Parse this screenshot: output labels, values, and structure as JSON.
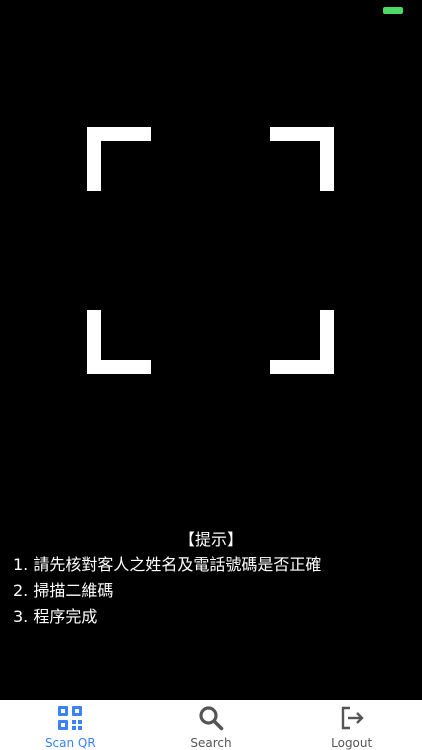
{
  "hints": {
    "title": "【提示】",
    "items": [
      "1. 請先核對客人之姓名及電話號碼是否正確",
      "2. 掃描二維碼",
      "3. 程序完成"
    ]
  },
  "tabs": [
    {
      "label": "Scan QR",
      "icon": "qr-code-icon",
      "active": true
    },
    {
      "label": "Search",
      "icon": "search-icon",
      "active": false
    },
    {
      "label": "Logout",
      "icon": "logout-icon",
      "active": false
    }
  ],
  "colors": {
    "background": "#000000",
    "accent": "#3a82f7",
    "battery": "#4cd964",
    "tab_inactive": "#555555"
  }
}
